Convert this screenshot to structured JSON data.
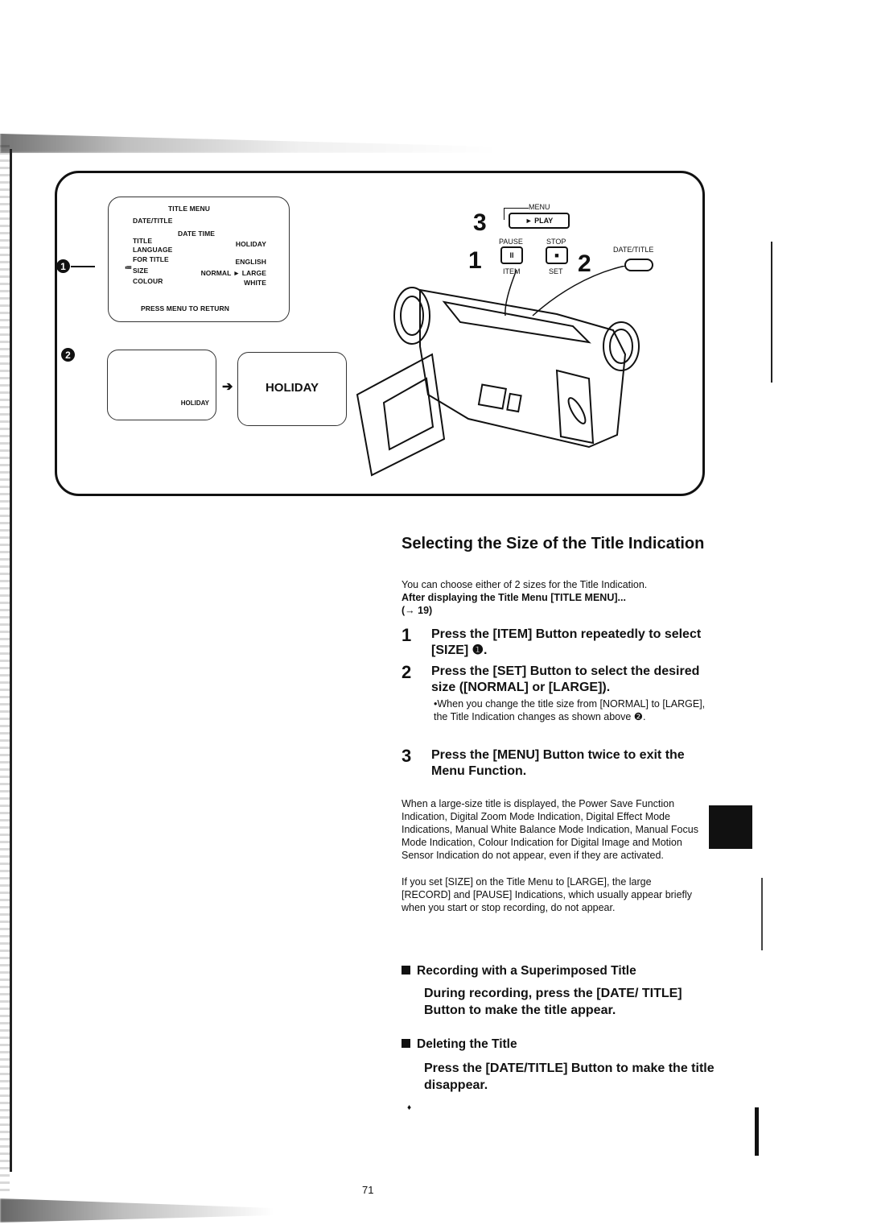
{
  "page": {
    "number": "71"
  },
  "illustration": {
    "marker_1": "1",
    "marker_2": "2",
    "title_menu": {
      "header": "TITLE MENU",
      "rows": [
        {
          "label": "DATE/TITLE",
          "value": ""
        },
        {
          "label": "",
          "value": "DATE  TIME"
        },
        {
          "label": "TITLE",
          "value": "HOLIDAY"
        },
        {
          "label": "LANGUAGE",
          "value": ""
        },
        {
          "label": "FOR TITLE",
          "value": "ENGLISH"
        },
        {
          "label": "SIZE",
          "value": "NORMAL ► LARGE"
        },
        {
          "label": "COLOUR",
          "value": "WHITE"
        }
      ],
      "footer": "PRESS MENU TO RETURN"
    },
    "normal_screen_text": "HOLIDAY",
    "large_screen_text": "HOLIDAY",
    "arrow": "➔",
    "buttons": {
      "step_3": "3",
      "menu_label": "MENU",
      "play_label": "► PLAY",
      "pause_label": "PAUSE",
      "stop_label": "STOP",
      "pause_glyph": "II",
      "stop_glyph": "■",
      "step_1": "1",
      "step_2": "2",
      "item_label": "ITEM",
      "set_label": "SET",
      "date_title_label": "DATE/TITLE"
    }
  },
  "section": {
    "heading": "Selecting the Size of the Title Indication",
    "intro": "You can choose either of 2 sizes for the Title Indication.",
    "prereq": "After displaying the Title Menu [TITLE MENU]...",
    "prereq_ref": "(→ 19)",
    "steps": [
      {
        "num": "1",
        "text": "Press the [ITEM] Button repeatedly to select [SIZE] ❶."
      },
      {
        "num": "2",
        "text": "Press the [SET] Button to select the desired size ([NORMAL] or [LARGE]).",
        "note": "•When you change the title size from [NORMAL] to [LARGE], the Title Indication changes as shown above ❷."
      },
      {
        "num": "3",
        "text": "Press the [MENU] Button twice to exit the Menu Function."
      }
    ],
    "notes": [
      "When a large-size title is displayed, the Power Save Function Indication, Digital Zoom Mode Indication, Digital Effect Mode Indications, Manual White Balance Mode Indication, Manual Focus Mode Indication, Colour Indication for Digital Image and Motion Sensor Indication do not appear, even if they are activated.",
      "If you set [SIZE] on the Title Menu to [LARGE], the large [RECORD] and [PAUSE] Indications, which usually appear briefly when you start or stop recording, do not appear."
    ],
    "subsections": [
      {
        "heading": "Recording with a Superimposed Title",
        "body": "During recording, press the [DATE/ TITLE] Button to make the title appear."
      },
      {
        "heading": "Deleting the Title",
        "body": "Press the [DATE/TITLE] Button to make the title disappear."
      }
    ]
  }
}
